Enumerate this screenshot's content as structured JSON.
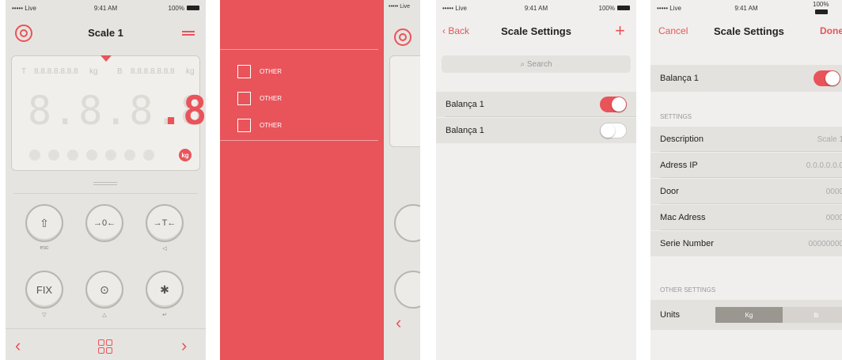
{
  "status": {
    "carrier": "••••• Live",
    "time": "9:41 AM",
    "battery": "100%"
  },
  "screen1": {
    "title": "Scale 1",
    "display": {
      "tare_label": "T",
      "tare_value": "8.8.8.8.8.8.8",
      "tare_unit": "kg",
      "b_label": "B",
      "b_value": "8.8.8.8.8.8.8",
      "b_unit": "kg",
      "digits": "8.8.8.8.8",
      "active_digit": ".8",
      "unit_badge": "kg"
    },
    "keys": [
      {
        "symbol": "⇧",
        "label": "esc"
      },
      {
        "symbol": "→0←",
        "label": ""
      },
      {
        "symbol": "→T←",
        "label": "◁"
      },
      {
        "symbol": "FIX",
        "label": "▽"
      },
      {
        "symbol": "⊙",
        "label": "△"
      },
      {
        "symbol": "✱",
        "label": "↵"
      }
    ],
    "nav": {
      "prev": "‹",
      "next": "›"
    }
  },
  "screen2": {
    "menu_items": [
      {
        "label": "OTHER"
      },
      {
        "label": "OTHER"
      },
      {
        "label": "OTHER"
      }
    ],
    "peek_status": "••••• Live",
    "peek_chev": "‹"
  },
  "screen3": {
    "back_label": "Back",
    "title": "Scale Settings",
    "add_label": "+",
    "search_placeholder": "Search",
    "scales": [
      {
        "name": "Balança 1",
        "enabled": true
      },
      {
        "name": "Balança 1",
        "enabled": false
      }
    ]
  },
  "screen4": {
    "cancel_label": "Cancel",
    "title": "Scale Settings",
    "done_label": "Done",
    "scale_name": "Balança 1",
    "scale_enabled": true,
    "settings_header": "SETTINGS",
    "settings": [
      {
        "label": "Description",
        "value": "Scale 1"
      },
      {
        "label": "Adress IP",
        "value": "0.0.0.0.0.0"
      },
      {
        "label": "Door",
        "value": "0000"
      },
      {
        "label": "Mac Adress",
        "value": "0000"
      },
      {
        "label": "Serie Number",
        "value": "00000000"
      }
    ],
    "other_header": "OTHER SETTINGS",
    "units_label": "Units",
    "units_options": [
      "Kg",
      "lb"
    ],
    "units_selected": "Kg"
  },
  "colors": {
    "accent": "#e8545a",
    "background": "#e6e4e0"
  }
}
